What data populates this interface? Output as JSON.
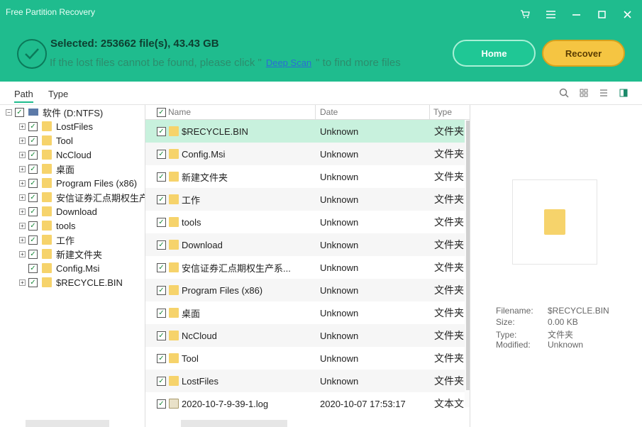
{
  "app": {
    "title": "Free Partition Recovery"
  },
  "window_controls": [
    "cart-icon",
    "menu-icon",
    "minimize-icon",
    "maximize-icon",
    "close-icon"
  ],
  "header": {
    "selected": "Selected: 253662 file(s), 43.43 GB",
    "hint_before": "If the lost files cannot be found, please click \"",
    "deep_scan": "Deep Scan",
    "hint_after": "\" to find more files",
    "home_label": "Home",
    "recover_label": "Recover"
  },
  "tabs": [
    "Path",
    "Type"
  ],
  "tree": {
    "root": "软件 (D:NTFS)",
    "items": [
      {
        "label": "LostFiles",
        "expandable": true
      },
      {
        "label": "Tool",
        "expandable": true
      },
      {
        "label": "NcCloud",
        "expandable": true
      },
      {
        "label": "桌面",
        "expandable": true
      },
      {
        "label": "Program Files (x86)",
        "expandable": true
      },
      {
        "label": "安信证券汇点期权生产系",
        "expandable": true
      },
      {
        "label": "Download",
        "expandable": true
      },
      {
        "label": "tools",
        "expandable": true
      },
      {
        "label": "工作",
        "expandable": true
      },
      {
        "label": "新建文件夹",
        "expandable": true
      },
      {
        "label": "Config.Msi",
        "expandable": false
      },
      {
        "label": "$RECYCLE.BIN",
        "expandable": true
      }
    ]
  },
  "table": {
    "columns": [
      "Name",
      "Date",
      "Type"
    ],
    "rows": [
      {
        "name": "$RECYCLE.BIN",
        "date": "Unknown",
        "type": "文件夹",
        "kind": "folder"
      },
      {
        "name": "Config.Msi",
        "date": "Unknown",
        "type": "文件夹",
        "kind": "folder"
      },
      {
        "name": "新建文件夹",
        "date": "Unknown",
        "type": "文件夹",
        "kind": "folder"
      },
      {
        "name": "工作",
        "date": "Unknown",
        "type": "文件夹",
        "kind": "folder"
      },
      {
        "name": "tools",
        "date": "Unknown",
        "type": "文件夹",
        "kind": "folder"
      },
      {
        "name": "Download",
        "date": "Unknown",
        "type": "文件夹",
        "kind": "folder"
      },
      {
        "name": "安信证券汇点期权生产系...",
        "date": "Unknown",
        "type": "文件夹",
        "kind": "folder"
      },
      {
        "name": "Program Files (x86)",
        "date": "Unknown",
        "type": "文件夹",
        "kind": "folder"
      },
      {
        "name": "桌面",
        "date": "Unknown",
        "type": "文件夹",
        "kind": "folder"
      },
      {
        "name": "NcCloud",
        "date": "Unknown",
        "type": "文件夹",
        "kind": "folder"
      },
      {
        "name": "Tool",
        "date": "Unknown",
        "type": "文件夹",
        "kind": "folder"
      },
      {
        "name": "LostFiles",
        "date": "Unknown",
        "type": "文件夹",
        "kind": "folder"
      },
      {
        "name": "2020-10-7-9-39-1.log",
        "date": "2020-10-07 17:53:17",
        "type": "文本文",
        "kind": "file"
      }
    ]
  },
  "preview": {
    "filename_label": "Filename:",
    "filename": "$RECYCLE.BIN",
    "size_label": "Size:",
    "size": "0.00 KB",
    "type_label": "Type:",
    "type": "文件夹",
    "modified_label": "Modified:",
    "modified": "Unknown"
  }
}
